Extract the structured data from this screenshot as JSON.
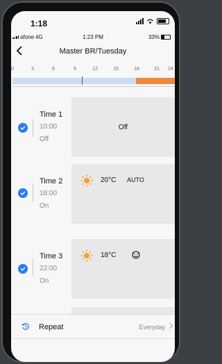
{
  "ios_status": {
    "time": "1:18"
  },
  "app_status": {
    "carrier": "afone",
    "network": "4G",
    "time": "1:23 PM",
    "battery": "33%"
  },
  "nav": {
    "back_icon": "chevron-left-icon",
    "title": "Master BR/Tuesday"
  },
  "timeline": {
    "ticks": [
      "0",
      "3",
      "6",
      "9",
      "12",
      "15",
      "18",
      "21",
      "24"
    ],
    "colors": {
      "base": "#ccdcf4",
      "active": "#f08a3b"
    }
  },
  "schedules": [
    {
      "label": "Time 1",
      "time": "10:00",
      "state": "Off",
      "enabled": true,
      "card": {
        "text": "Off"
      }
    },
    {
      "label": "Time 2",
      "time": "18:00",
      "state": "On",
      "enabled": true,
      "card": {
        "temp": "20°C",
        "mode": "AUTO"
      }
    },
    {
      "label": "Time 3",
      "time": "22:00",
      "state": "On",
      "enabled": true,
      "card": {
        "temp": "18°C",
        "mode_icon": "fan-face-icon"
      }
    }
  ],
  "repeat": {
    "label": "Repeat",
    "value": "Everyday"
  },
  "accent_color": "#2b7cf0",
  "sun_color": "#f5a033"
}
